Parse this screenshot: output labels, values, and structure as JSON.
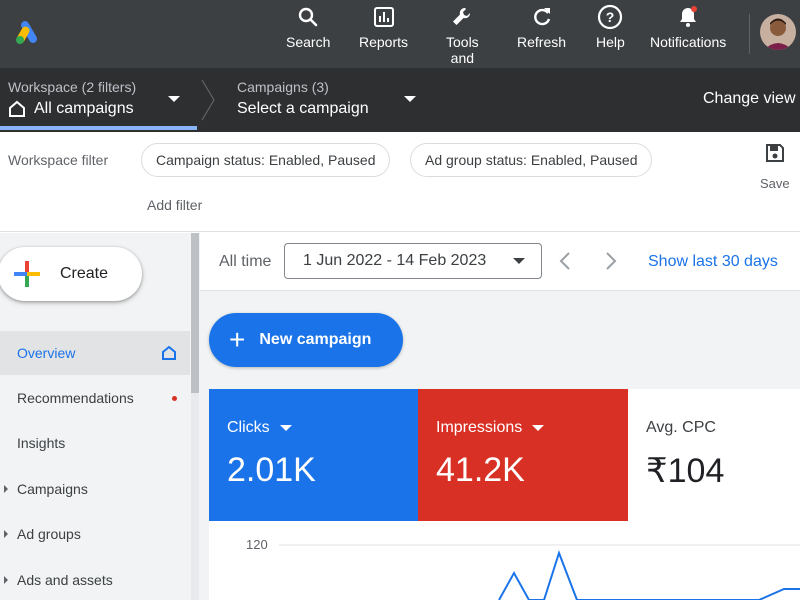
{
  "topnav": {
    "items": [
      {
        "label": "Search",
        "icon": "search-icon"
      },
      {
        "label": "Reports",
        "icon": "reports-icon"
      },
      {
        "label": "Tools\nand",
        "icon": "tools-icon"
      },
      {
        "label": "Refresh",
        "icon": "refresh-icon"
      },
      {
        "label": "Help",
        "icon": "help-icon"
      },
      {
        "label": "Notifications",
        "icon": "bell-icon"
      }
    ]
  },
  "workspace": {
    "label": "Workspace (2 filters)",
    "value": "All campaigns",
    "campaigns_label": "Campaigns (3)",
    "campaigns_value": "Select a campaign",
    "change_view": "Change view"
  },
  "filters": {
    "label": "Workspace filter",
    "chips": [
      "Campaign status: Enabled, Paused",
      "Ad group status: Enabled, Paused"
    ],
    "add_filter": "Add filter",
    "save": "Save"
  },
  "sidebar": {
    "create": "Create",
    "items": [
      {
        "label": "Overview",
        "active": true
      },
      {
        "label": "Recommendations"
      },
      {
        "label": "Insights"
      },
      {
        "label": "Campaigns"
      },
      {
        "label": "Ad groups"
      },
      {
        "label": "Ads and assets"
      }
    ]
  },
  "datebar": {
    "all_time": "All time",
    "range": "1 Jun 2022 - 14 Feb 2023",
    "show_last": "Show last 30 days"
  },
  "main": {
    "new_campaign": "New campaign"
  },
  "metrics": {
    "clicks": {
      "label": "Clicks",
      "value": "2.01K"
    },
    "impressions": {
      "label": "Impressions",
      "value": "41.2K"
    },
    "cpc": {
      "label": "Avg. CPC",
      "value": "₹104"
    }
  },
  "chart": {
    "y_tick": "120"
  },
  "colors": {
    "accent": "#1a73e8",
    "impressions": "#d93025",
    "topbar": "#3c4043"
  }
}
